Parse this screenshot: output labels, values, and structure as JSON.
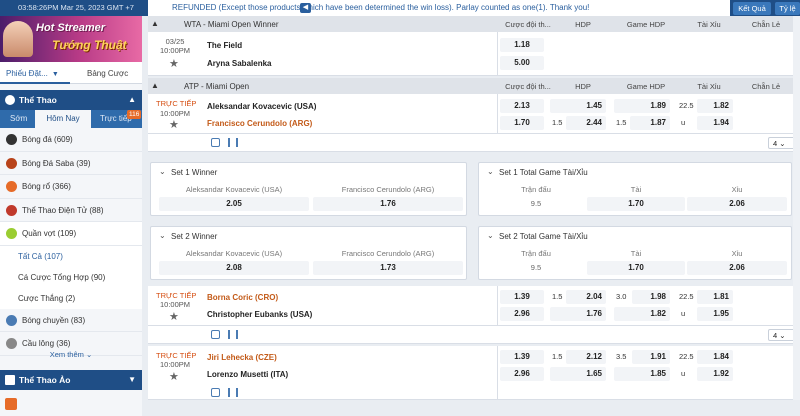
{
  "topbar": {
    "time": "03:58:26PM Mar 25, 2023 GMT +7",
    "notice": "REFUNDED (Except those products which have been determined the win loss). Parlay counted as one(1). Thank you!",
    "results_btn": "Kết Quả",
    "rates_btn": "Tỷ lệ"
  },
  "sidebar": {
    "banner": {
      "line1": "Hot Streamer",
      "line2": "Tướng Thuật"
    },
    "tabs": {
      "bet_slip": "Phiếu Đặt...",
      "my_bets": "Bảng Cược"
    },
    "sport_header": "Thể Thao",
    "subtabs": {
      "early": "Sớm",
      "today": "Hôm Nay",
      "live": "Trực tiếp",
      "live_count": "116"
    },
    "sports": [
      {
        "label": "Bóng đá (609)",
        "color": "#333333"
      },
      {
        "label": "Bóng Đá Saba (39)",
        "color": "#b8431a"
      },
      {
        "label": "Bóng rổ (366)",
        "color": "#e66b28"
      },
      {
        "label": "Thể Thao Điện Tử (88)",
        "color": "#c0392b"
      }
    ],
    "tennis": {
      "label": "Quần vợt (109)",
      "color": "#9acd32"
    },
    "tennis_sub": [
      "Tất Cả (107)",
      "Cá Cược Tổng Hợp (90)",
      "Cược Thắng (2)"
    ],
    "sports2": [
      {
        "label": "Bóng chuyền (83)",
        "color": "#4a7bb3"
      },
      {
        "label": "Cầu lông (36)",
        "color": "#888888"
      }
    ],
    "see_more": "Xem thêm",
    "virtual": "Thể Thao Ảo"
  },
  "headers": {
    "main_odds": "Cược đội th...",
    "hdp": "HDP",
    "game_hdp": "Game HDP",
    "ou": "Tài Xỉu",
    "odd_even": "Chẵn Lẻ"
  },
  "leagues": {
    "wta": "WTA - Miami Open Winner",
    "atp": "ATP - Miami Open"
  },
  "wta_match": {
    "date": "03/25",
    "time": "10:00PM",
    "home": "The Field",
    "away": "Aryna Sabalenka",
    "odds_home": "1.18",
    "odds_away": "5.00"
  },
  "match1": {
    "live": "TRỰC TIẾP",
    "time": "10:00PM",
    "home": "Aleksandar Kovacevic (USA)",
    "away": "Francisco Cerundolo (ARG)",
    "ml": [
      "2.13",
      "1.70"
    ],
    "hdp_line": [
      "",
      "1.5"
    ],
    "hdp": [
      "1.45",
      "2.44"
    ],
    "ghdp_line": [
      "",
      "1.5"
    ],
    "ghdp": [
      "1.89",
      "1.87"
    ],
    "ou_line": [
      "22.5",
      "u"
    ],
    "ou": [
      "1.82",
      "1.94"
    ],
    "more": "4"
  },
  "set1_winner": {
    "title": "Set 1 Winner",
    "p1": "Aleksandar Kovacevic (USA)",
    "p2": "Francisco Cerundolo (ARG)",
    "o1": "2.05",
    "o2": "1.76"
  },
  "set1_total": {
    "title": "Set 1 Total Game Tài/Xỉu",
    "c1": "Trận đấu",
    "c2": "Tài",
    "c3": "Xỉu",
    "line": "9.5",
    "o1": "1.70",
    "o2": "2.06"
  },
  "set2_winner": {
    "title": "Set 2 Winner",
    "p1": "Aleksandar Kovacevic (USA)",
    "p2": "Francisco Cerundolo (ARG)",
    "o1": "2.08",
    "o2": "1.73"
  },
  "set2_total": {
    "title": "Set 2 Total Game Tài/Xỉu",
    "c1": "Trận đấu",
    "c2": "Tài",
    "c3": "Xỉu",
    "line": "9.5",
    "o1": "1.70",
    "o2": "2.06"
  },
  "match2": {
    "live": "TRỰC TIẾP",
    "time": "10:00PM",
    "home": "Borna Coric (CRO)",
    "away": "Christopher Eubanks (USA)",
    "ml": [
      "1.39",
      "2.96"
    ],
    "hdp_line": [
      "1.5",
      ""
    ],
    "hdp": [
      "2.04",
      "1.76"
    ],
    "ghdp_line": [
      "3.0",
      ""
    ],
    "ghdp": [
      "1.98",
      "1.82"
    ],
    "ou_line": [
      "22.5",
      "u"
    ],
    "ou": [
      "1.81",
      "1.95"
    ],
    "more": "4"
  },
  "match3": {
    "live": "TRỰC TIẾP",
    "time": "10:00PM",
    "home": "Jiri Lehecka (CZE)",
    "away": "Lorenzo Musetti (ITA)",
    "ml": [
      "1.39",
      "2.96"
    ],
    "hdp_line": [
      "1.5",
      ""
    ],
    "hdp": [
      "2.12",
      "1.65"
    ],
    "ghdp_line": [
      "3.5",
      ""
    ],
    "ghdp": [
      "1.91",
      "1.85"
    ],
    "ou_line": [
      "22.5",
      "u"
    ],
    "ou": [
      "1.84",
      "1.92"
    ]
  }
}
